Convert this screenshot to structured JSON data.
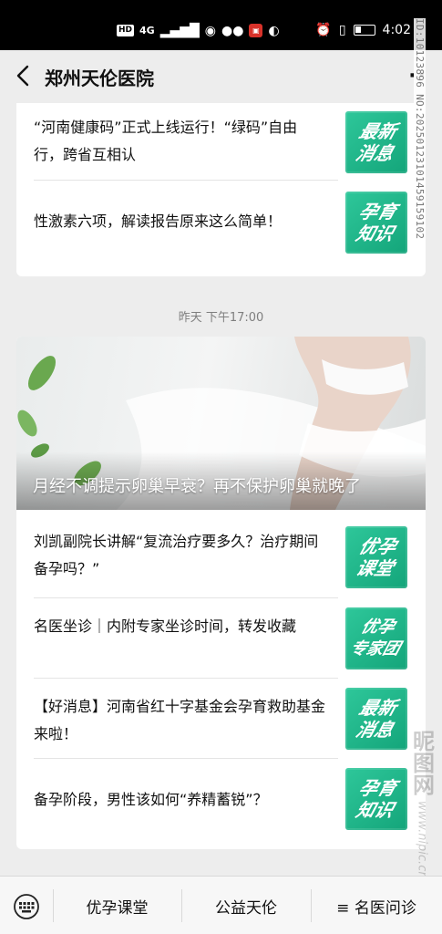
{
  "status_bar": {
    "hd": "HD",
    "network": "4G",
    "signal_icon": "signal-icon",
    "time": "4:02"
  },
  "nav": {
    "title": "郑州天伦医院",
    "back_icon": "back-chevron-icon",
    "more_icon": "more-dots-icon",
    "more_text": "··"
  },
  "watermark": {
    "id_text": "ID:10123896 NO:20250123101459159102",
    "brand": "昵图网",
    "url": "www.nipic.cn"
  },
  "top_card": {
    "items": [
      {
        "title": "“河南健康码”正式上线运行！“绿码”自由行，跨省互相认",
        "thumb_lines": [
          "最新",
          "消息"
        ]
      },
      {
        "title": "性激素六项，解读报告原来这么简单！",
        "thumb_lines": [
          "孕育",
          "知识"
        ]
      }
    ]
  },
  "timestamp": "昨天 下午17:00",
  "main_card": {
    "cover_title": "月经不调提示卵巢早衰？再不保护卵巢就晚了",
    "items": [
      {
        "title": "刘凯副院长讲解“复流治疗要多久？治疗期间备孕吗？”",
        "thumb_lines": [
          "优孕",
          "课堂"
        ]
      },
      {
        "title": "名医坐诊｜内附专家坐诊时间，转发收藏",
        "thumb_lines": [
          "优孕",
          "专家团"
        ]
      },
      {
        "title": "【好消息】河南省红十字基金会孕育救助基金来啦！",
        "thumb_lines": [
          "最新",
          "消息"
        ]
      },
      {
        "title": "备孕阶段，男性该如何“养精蓄锐”？",
        "thumb_lines": [
          "孕育",
          "知识"
        ]
      }
    ]
  },
  "bottom_menu": {
    "keyboard_icon": "keyboard-icon",
    "items": [
      "优孕课堂",
      "公益天伦",
      "≡ 名医问诊"
    ]
  },
  "colors": {
    "accent_green": "#1aad80",
    "background": "#ededed"
  }
}
